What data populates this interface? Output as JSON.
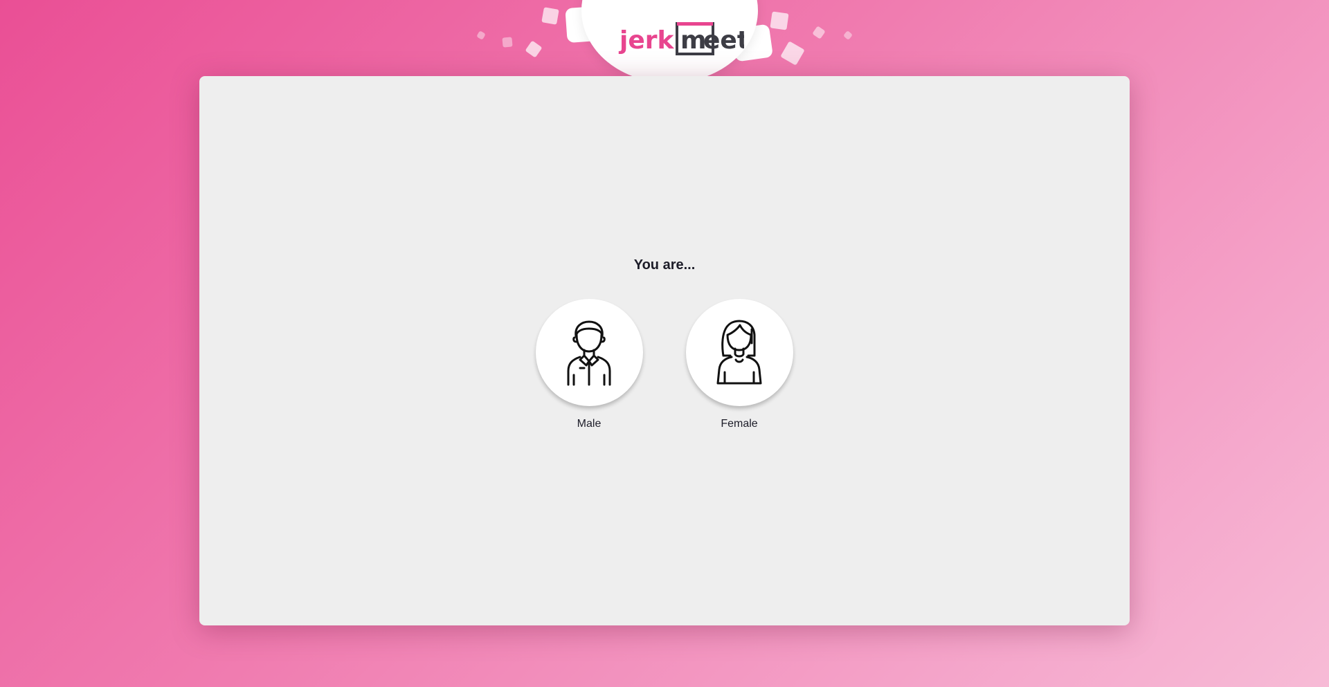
{
  "brand": {
    "logo_part_1": "jerk",
    "logo_part_2": "m",
    "logo_part_3": "eet",
    "primary_color": "#e8458f",
    "dark_color": "#3d3d45"
  },
  "form": {
    "prompt": "You are...",
    "options": [
      {
        "label": "Male",
        "icon": "male-avatar-icon"
      },
      {
        "label": "Female",
        "icon": "female-avatar-icon"
      }
    ]
  }
}
